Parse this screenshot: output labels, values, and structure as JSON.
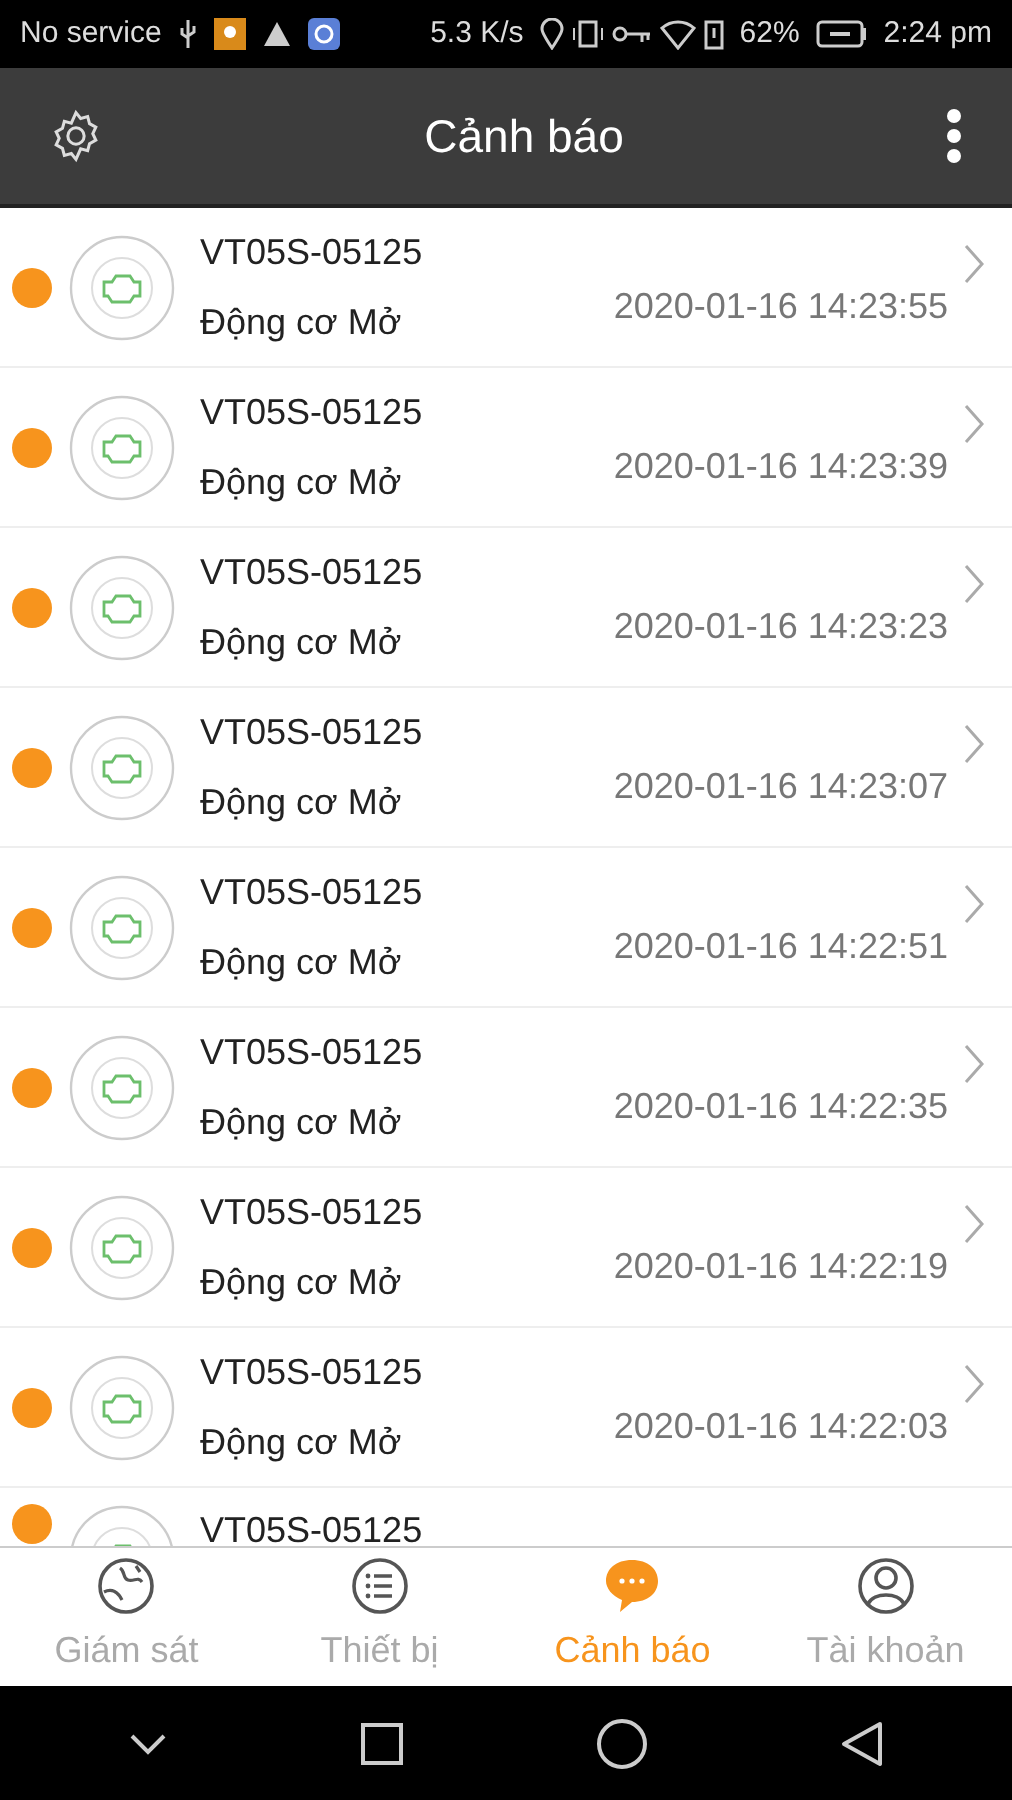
{
  "status_bar": {
    "carrier": "No service",
    "speed": "5.3 K/s",
    "battery": "62%",
    "time": "2:24 pm"
  },
  "header": {
    "title": "Cảnh báo"
  },
  "alerts": [
    {
      "plate": "VT05S-05125",
      "event": "Động cơ Mở",
      "time": "2020-01-16 14:23:55",
      "color": "#f7941d"
    },
    {
      "plate": "VT05S-05125",
      "event": "Động cơ Mở",
      "time": "2020-01-16 14:23:39",
      "color": "#f7941d"
    },
    {
      "plate": "VT05S-05125",
      "event": "Động cơ Mở",
      "time": "2020-01-16 14:23:23",
      "color": "#f7941d"
    },
    {
      "plate": "VT05S-05125",
      "event": "Động cơ Mở",
      "time": "2020-01-16 14:23:07",
      "color": "#f7941d"
    },
    {
      "plate": "VT05S-05125",
      "event": "Động cơ Mở",
      "time": "2020-01-16 14:22:51",
      "color": "#f7941d"
    },
    {
      "plate": "VT05S-05125",
      "event": "Động cơ Mở",
      "time": "2020-01-16 14:22:35",
      "color": "#f7941d"
    },
    {
      "plate": "VT05S-05125",
      "event": "Động cơ Mở",
      "time": "2020-01-16 14:22:19",
      "color": "#f7941d"
    },
    {
      "plate": "VT05S-05125",
      "event": "Động cơ Mở",
      "time": "2020-01-16 14:22:03",
      "color": "#f7941d"
    },
    {
      "plate": "VT05S-05125",
      "color": "#f7941d"
    }
  ],
  "tabs": [
    {
      "label": "Giám sát",
      "kind": "map",
      "selected": false
    },
    {
      "label": "Thiết bị",
      "kind": "list",
      "selected": false
    },
    {
      "label": "Cảnh báo",
      "kind": "chat",
      "selected": true
    },
    {
      "label": "Tài khoản",
      "kind": "user",
      "selected": false
    }
  ]
}
